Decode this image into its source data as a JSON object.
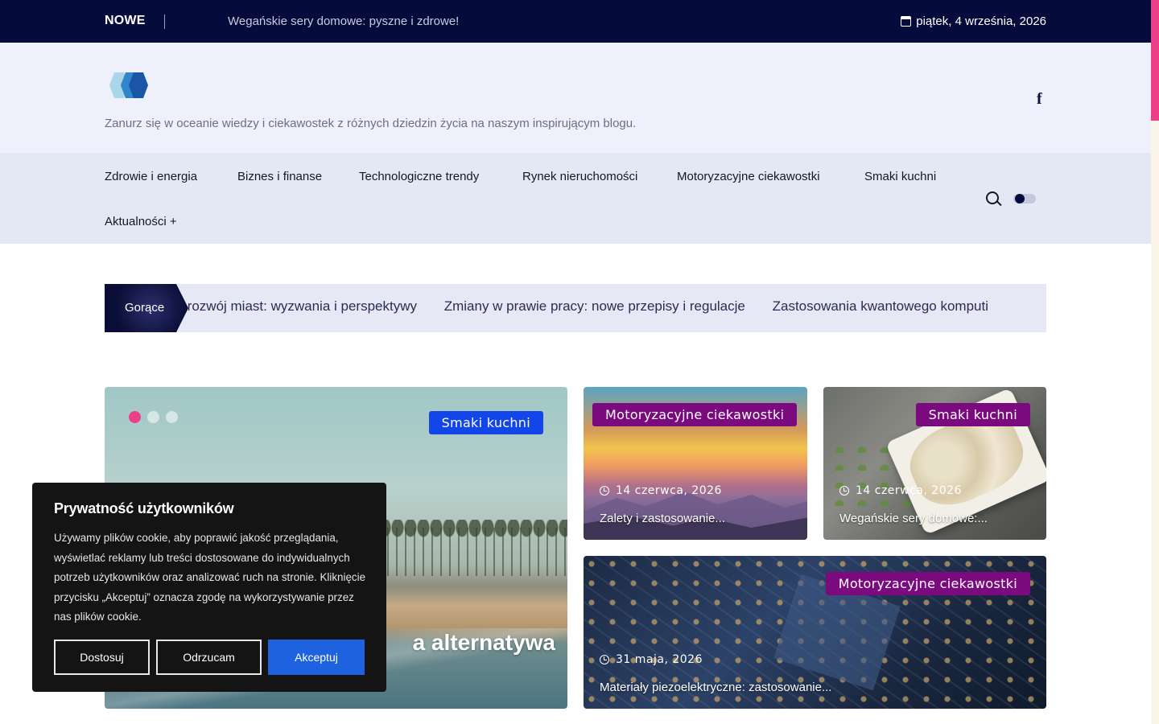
{
  "topbar": {
    "label": "NOWE",
    "ticker": "Wegańskie sery domowe: pyszne i zdrowe!",
    "date": "piątek, 4 września, 2026"
  },
  "header": {
    "tagline": "Zanurz się w oceanie wiedzy i ciekawostek z różnych dziedzin życia na naszym inspirującym blogu.",
    "social_icon": "f"
  },
  "nav": {
    "items": [
      "Zdrowie i energia",
      "Biznes i finanse",
      "Technologiczne trendy",
      "Rynek nieruchomości",
      "Motoryzacyjne ciekawostki",
      "Smaki kuchni",
      "Aktualności +"
    ]
  },
  "hot": {
    "label": "Gorące",
    "items": [
      "ny rozwój miast: wyzwania i perspektywy",
      "Zmiany w prawie pracy: nowe przepisy i regulacje",
      "Zastosowania kwantowego komputi"
    ]
  },
  "featured": {
    "category": "Smaki kuchni",
    "title_visible": "a alternatywa"
  },
  "cards": [
    {
      "category": "Motoryzacyjne ciekawostki",
      "date": "14 czerwca, 2026",
      "title": "Zalety i zastosowanie..."
    },
    {
      "category": "Smaki kuchni",
      "date": "14 czerwca, 2026",
      "title": "Wegańskie sery domowe:..."
    },
    {
      "category": "Motoryzacyjne ciekawostki",
      "date": "31 maja, 2026",
      "title": "Materiały piezoelektryczne: zastosowanie..."
    }
  ],
  "cookie": {
    "title": "Prywatność użytkowników",
    "text": "Używamy plików cookie, aby poprawić jakość przeglądania, wyświetlać reklamy lub treści dostosowane do indywidualnych potrzeb użytkowników oraz analizować ruch na stronie. Kliknięcie przycisku „Akceptuj” oznacza zgodę na wykorzystywanie przez nas plików cookie.",
    "customize": "Dostosuj",
    "reject": "Odrzucam",
    "accept": "Akceptuj"
  },
  "colors": {
    "topbar": "#050b3b",
    "accent_pink": "#ec3f87",
    "category_blue": "#1346e8",
    "category_purple": "#7a0a7e",
    "accept_button": "#1e62e0"
  },
  "icons": [
    "calendar-icon",
    "facebook-icon",
    "search-icon",
    "theme-toggle",
    "clock-icon"
  ]
}
